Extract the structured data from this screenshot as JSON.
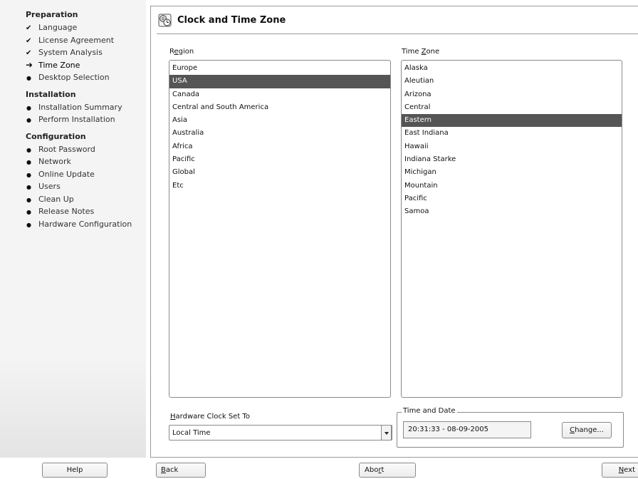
{
  "sidebar": {
    "sections": [
      {
        "title": "Preparation",
        "items": [
          {
            "label": "Language",
            "state": "done"
          },
          {
            "label": "License Agreement",
            "state": "done"
          },
          {
            "label": "System Analysis",
            "state": "done"
          },
          {
            "label": "Time Zone",
            "state": "current"
          },
          {
            "label": "Desktop Selection",
            "state": "pending"
          }
        ]
      },
      {
        "title": "Installation",
        "items": [
          {
            "label": "Installation Summary",
            "state": "pending"
          },
          {
            "label": "Perform Installation",
            "state": "pending"
          }
        ]
      },
      {
        "title": "Configuration",
        "items": [
          {
            "label": "Root Password",
            "state": "pending"
          },
          {
            "label": "Network",
            "state": "pending"
          },
          {
            "label": "Online Update",
            "state": "pending"
          },
          {
            "label": "Users",
            "state": "pending"
          },
          {
            "label": "Clean Up",
            "state": "pending"
          },
          {
            "label": "Release Notes",
            "state": "pending"
          },
          {
            "label": "Hardware Configuration",
            "state": "pending"
          }
        ]
      }
    ],
    "marks": {
      "done": "✔",
      "current": "➜",
      "pending": "●"
    }
  },
  "header": {
    "title": "Clock and Time Zone",
    "icon": "clock-globe-icon"
  },
  "region": {
    "label_prefix": "R",
    "label_accel": "e",
    "label_suffix": "gion",
    "items": [
      "Europe",
      "USA",
      "Canada",
      "Central and South America",
      "Asia",
      "Australia",
      "Africa",
      "Pacific",
      "Global",
      "Etc"
    ],
    "selected": "USA"
  },
  "timezone": {
    "label_prefix": "Time ",
    "label_accel": "Z",
    "label_suffix": "one",
    "items": [
      "Alaska",
      "Aleutian",
      "Arizona",
      "Central",
      "Eastern",
      "East Indiana",
      "Hawaii",
      "Indiana Starke",
      "Michigan",
      "Mountain",
      "Pacific",
      "Samoa"
    ],
    "selected": "Eastern"
  },
  "hwclock": {
    "label_accel": "H",
    "label_suffix": "ardware Clock Set To",
    "value": "Local Time"
  },
  "timedate": {
    "legend": "Time and Date",
    "value": "20:31:33 - 08-09-2005",
    "change_accel": "C",
    "change_suffix": "hange..."
  },
  "footer": {
    "help": "Help",
    "back_accel": "B",
    "back_suffix": "ack",
    "abort_prefix": "Abo",
    "abort_accel": "r",
    "abort_suffix": "t",
    "next_accel": "N",
    "next_suffix": "ext"
  },
  "colors": {
    "selection": "#555555",
    "border": "#8a8a8a",
    "sidebar_bg": "#f4f4f4"
  }
}
